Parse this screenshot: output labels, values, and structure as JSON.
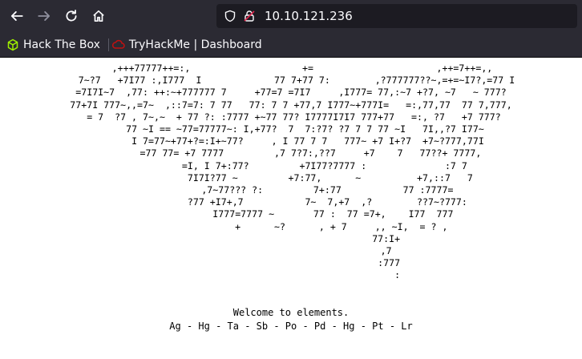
{
  "browser": {
    "url": "10.10.121.236",
    "bookmarks": [
      {
        "label": "Hack The Box",
        "icon": "hackthebox-cube-icon",
        "color": "#9fef00"
      },
      {
        "label": "TryHackMe | Dashboard",
        "icon": "tryhackme-cloud-icon",
        "color": "#c11111"
      }
    ]
  },
  "page": {
    "ascii_art": "    ,+++77777++=:,                    +=                      ,++=7++=,,\n  7~?7   +7I77 :,I777  I             77 7+77 7:        ,?777777??~,=+=~I7?,=77 I\n=7I7I~7  ,77: ++:~+777777 7     +77=7 =7I7     ,I777= 77,:~7 +?7, ~7   ~ 777?\n77+7I 777~,,=7~  ,::7=7: 7 77   77: 7 7 +77,7 I777~+777I=   =:,77,77  77 7,777,\n = 7  ?7 , 7~,~  + 77 ?: :7777 +~77 77? I7777I7I7 777+77   =:, ?7   +7 777?\n     77 ~I == ~77=77777~: I,+77?  7  7:?7? ?7 7 7 77 ~I   7I,,?7 I77~\n      I 7=77~+77+?=:I+~77?     , I 77 7 7   777~ +7 I+?7  +7~?777,77I\n       =77 77= +7 7777         ,7 7?7:,??7     +7    7   77??+ 7777,\n            =I, I 7+:77?         +7I77?7777 :              :7 7\n              7I7I?77 ~         +7:77,      ~          +7,::7   7\n             ,7~77??? ?:         7+:77           77 :7777=\n             ?77 +I7+,7           7~  7,+7  ,?        ??7~?777:\n               I777=7777 ~       77 :  77 =7+,    I77  777\n                  +      ~?      , + 7     ,, ~I,  = ? ,\n                                  77:I+\n                                  ,7\n                                   :777\n                                      :",
    "welcome": "Welcome to elements.",
    "elements_line": "Ag - Hg - Ta - Sb - Po - Pd - Hg - Pt - Lr"
  }
}
